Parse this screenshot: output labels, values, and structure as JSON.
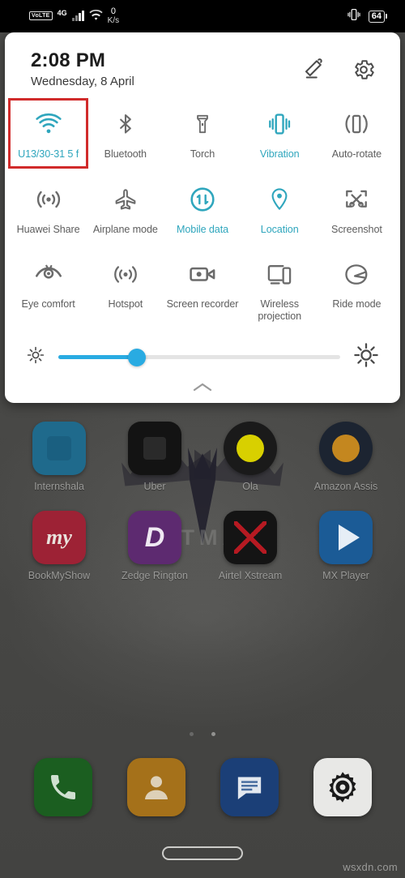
{
  "status_bar": {
    "volte_label": "VoLTE",
    "network_type": "4G",
    "signal_icon": "signal-bars-icon",
    "wifi_icon": "wifi-icon",
    "net_speed_value": "0",
    "net_speed_unit": "K/s",
    "vibrate_icon": "vibration-icon",
    "battery_percent": "64"
  },
  "quick_settings": {
    "time": "2:08 PM",
    "date": "Wednesday, 8 April",
    "edit_icon": "pencil-edit-icon",
    "settings_icon": "gear-icon",
    "accent_color": "#2fa6bd",
    "highlight_color": "#d12b2b",
    "slider_color": "#29abe2",
    "collapse_icon": "chevron-up-icon",
    "brightness": {
      "low_icon": "brightness-low-icon",
      "high_icon": "brightness-high-icon",
      "value_percent": 28
    },
    "rows": [
      [
        {
          "label": "U13/30-31 5 f",
          "icon": "wifi-icon",
          "active": true,
          "highlighted": true
        },
        {
          "label": "Bluetooth",
          "icon": "bluetooth-icon",
          "active": false,
          "highlighted": false
        },
        {
          "label": "Torch",
          "icon": "flashlight-icon",
          "active": false,
          "highlighted": false
        },
        {
          "label": "Vibration",
          "icon": "vibration-icon",
          "active": true,
          "highlighted": false
        },
        {
          "label": "Auto-rotate",
          "icon": "auto-rotate-icon",
          "active": false,
          "highlighted": false
        }
      ],
      [
        {
          "label": "Huawei Share",
          "icon": "huawei-share-icon",
          "active": false,
          "highlighted": false
        },
        {
          "label": "Airplane mode",
          "icon": "airplane-icon",
          "active": false,
          "highlighted": false
        },
        {
          "label": "Mobile data",
          "icon": "mobile-data-icon",
          "active": true,
          "highlighted": false
        },
        {
          "label": "Location",
          "icon": "location-pin-icon",
          "active": true,
          "highlighted": false
        },
        {
          "label": "Screenshot",
          "icon": "screenshot-icon",
          "active": false,
          "highlighted": false
        }
      ],
      [
        {
          "label": "Eye comfort",
          "icon": "eye-icon",
          "active": false,
          "highlighted": false
        },
        {
          "label": "Hotspot",
          "icon": "hotspot-icon",
          "active": false,
          "highlighted": false
        },
        {
          "label": "Screen recorder",
          "icon": "screen-recorder-icon",
          "active": false,
          "highlighted": false
        },
        {
          "label": "Wireless projection",
          "icon": "wireless-projection-icon",
          "active": false,
          "highlighted": false
        },
        {
          "label": "Ride mode",
          "icon": "ride-mode-icon",
          "active": false,
          "highlighted": false
        }
      ]
    ]
  },
  "home_screen": {
    "wallpaper_text": "BATMAN",
    "app_rows": [
      [
        {
          "label": "Internshala",
          "icon": "internshala-app-icon"
        },
        {
          "label": "Uber",
          "icon": "uber-app-icon"
        },
        {
          "label": "Ola",
          "icon": "ola-app-icon"
        },
        {
          "label": "Amazon Assis",
          "icon": "amazon-assistant-app-icon"
        }
      ],
      [
        {
          "label": "BookMyShow",
          "icon": "bookmyshow-app-icon"
        },
        {
          "label": "Zedge Rington",
          "icon": "zedge-app-icon"
        },
        {
          "label": "Airtel Xstream",
          "icon": "airtel-xstream-app-icon"
        },
        {
          "label": "MX Player",
          "icon": "mxplayer-app-icon"
        }
      ]
    ],
    "dock": [
      {
        "label": "Phone",
        "icon": "phone-icon"
      },
      {
        "label": "Contacts",
        "icon": "contacts-icon"
      },
      {
        "label": "Messages",
        "icon": "messages-icon"
      },
      {
        "label": "Settings",
        "icon": "settings-gear-icon"
      }
    ],
    "gesture_bar_icon": "gesture-home-bar"
  },
  "watermark": "wsxdn.com"
}
